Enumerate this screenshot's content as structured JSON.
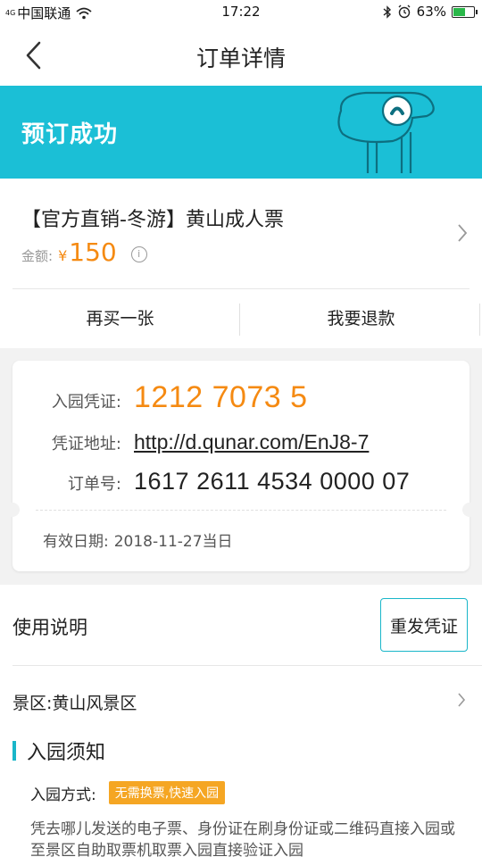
{
  "status_bar": {
    "signal": "4G",
    "carrier": "中国联通",
    "time": "17:22",
    "battery": "63%",
    "battery_level": 0.63
  },
  "nav": {
    "title": "订单详情"
  },
  "banner": {
    "text": "预订成功",
    "color": "#1bbfd6"
  },
  "product": {
    "name": "【官方直销-冬游】黄山成人票",
    "price_label": "金额:",
    "currency": "¥",
    "price": "150",
    "info_symbol": "i",
    "actions": {
      "buy_again": "再买一张",
      "refund": "我要退款"
    }
  },
  "voucher": {
    "code_label": "入园凭证:",
    "code": "1212 7073 5",
    "url_label": "凭证地址:",
    "url": "http://d.qunar.com/EnJ8-7",
    "order_label": "订单号:",
    "order_no": "1617 2611 4534 0000 07",
    "valid_label": "有效日期:",
    "valid_date": "2018-11-27当日"
  },
  "instructions": {
    "title": "使用说明",
    "resend_button": "重发凭证",
    "scenic_area": "景区:黄山风景区",
    "notice_title": "入园须知",
    "entry_method_label": "入园方式:",
    "entry_method_tag": "无需换票,快速入园",
    "description": "凭去哪儿发送的电子票、身份证在刷身份证或二维码直接入园或至景区自助取票机取票入园直接验证入园"
  },
  "colors": {
    "accent": "#19b6c9",
    "price": "#f58a12",
    "tag": "#f5a623"
  }
}
